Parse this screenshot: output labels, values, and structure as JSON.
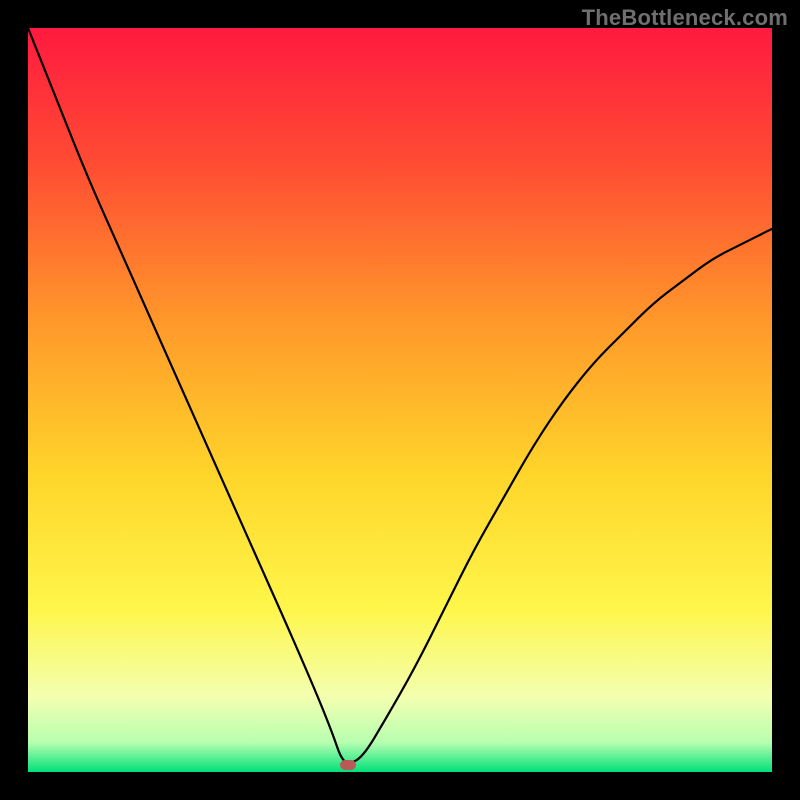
{
  "watermark": {
    "text": "TheBottleneck.com",
    "color": "#6f6f6f"
  },
  "chart_data": {
    "type": "line",
    "title": "",
    "xlabel": "",
    "ylabel": "",
    "xlim": [
      0,
      100
    ],
    "ylim": [
      0,
      100
    ],
    "grid": "off",
    "legend": "none",
    "background": "vertical-rainbow-gradient",
    "gradient_stops": [
      {
        "pct": 0,
        "color": "#ff1a3f"
      },
      {
        "pct": 18,
        "color": "#ff4b33"
      },
      {
        "pct": 40,
        "color": "#ff9a2a"
      },
      {
        "pct": 60,
        "color": "#ffd52a"
      },
      {
        "pct": 78,
        "color": "#fff64a"
      },
      {
        "pct": 90,
        "color": "#f3ffb0"
      },
      {
        "pct": 96,
        "color": "#b8ffb0"
      },
      {
        "pct": 100,
        "color": "#00e07a"
      }
    ],
    "series": [
      {
        "name": "bottleneck-curve",
        "color": "#000000",
        "x": [
          0,
          4,
          8,
          12,
          16,
          20,
          24,
          28,
          32,
          36,
          39,
          41,
          42,
          43,
          45,
          48,
          52,
          56,
          60,
          64,
          68,
          72,
          76,
          80,
          84,
          88,
          92,
          96,
          100
        ],
        "y": [
          100,
          90,
          80,
          71,
          62,
          53,
          44,
          35,
          26,
          17,
          10,
          5,
          2,
          1,
          2,
          7,
          14,
          22,
          30,
          37,
          44,
          50,
          55,
          59,
          63,
          66,
          69,
          71,
          73
        ]
      }
    ],
    "marker": {
      "x": 43,
      "y": 1,
      "color": "#b95a5a",
      "shape": "rounded-rect"
    },
    "annotations": []
  }
}
